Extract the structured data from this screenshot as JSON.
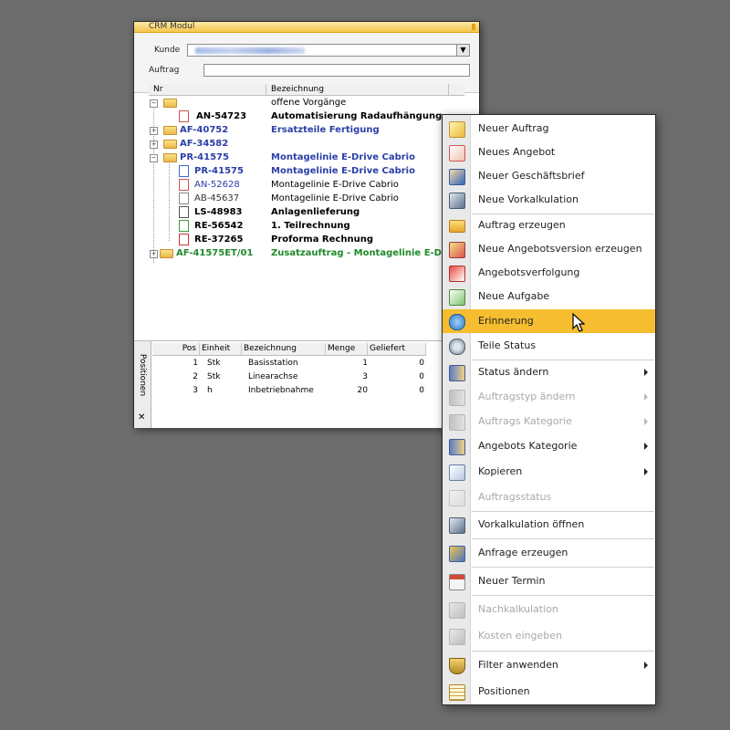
{
  "window": {
    "title": "CRM Modul"
  },
  "form": {
    "kunde_label": "Kunde",
    "auftrag_label": "Auftrag",
    "auftrag_value": ""
  },
  "tree": {
    "col_nr": "Nr",
    "col_bez": "Bezeichnung",
    "rows": [
      {
        "nr": "",
        "bez": "offene Vorgänge"
      },
      {
        "nr": "AN-54723",
        "bez": "Automatisierung Radaufhängung"
      },
      {
        "nr": "AF-40752",
        "bez": "Ersatzteile Fertigung"
      },
      {
        "nr": "AF-34582",
        "bez": ""
      },
      {
        "nr": "PR-41575",
        "bez": "Montagelinie E-Drive Cabrio"
      },
      {
        "nr": "PR-41575",
        "bez": "Montagelinie E-Drive Cabrio"
      },
      {
        "nr": "AN-52628",
        "bez": "Montagelinie E-Drive Cabrio"
      },
      {
        "nr": "AB-45637",
        "bez": "Montagelinie E-Drive Cabrio"
      },
      {
        "nr": "LS-48983",
        "bez": "Anlagenlieferung"
      },
      {
        "nr": "RE-56542",
        "bez": "1. Teilrechnung"
      },
      {
        "nr": "RE-37265",
        "bez": "Proforma Rechnung"
      },
      {
        "nr": "AF-41575ET/01",
        "bez": "Zusatzauftrag - Montagelinie E-Driv..."
      }
    ]
  },
  "positions": {
    "tab_label": "Positionen",
    "close": "✕",
    "headers": {
      "pos": "Pos",
      "einheit": "Einheit",
      "bez": "Bezeichnung",
      "menge": "Menge",
      "geliefert": "Geliefert"
    },
    "rows": [
      {
        "pos": "1",
        "einheit": "Stk",
        "bez": "Basisstation",
        "menge": "1",
        "geliefert": "0"
      },
      {
        "pos": "2",
        "einheit": "Stk",
        "bez": "Linearachse",
        "menge": "3",
        "geliefert": "0"
      },
      {
        "pos": "3",
        "einheit": "h",
        "bez": "Inbetriebnahme",
        "menge": "20",
        "geliefert": "0"
      }
    ]
  },
  "menu": {
    "items": [
      {
        "label": "Neuer Auftrag",
        "icon": "new-order-icon"
      },
      {
        "label": "Neues Angebot",
        "icon": "new-offer-icon"
      },
      {
        "label": "Neuer Geschäftsbrief",
        "icon": "business-letter-icon"
      },
      {
        "label": "Neue Vorkalkulation",
        "icon": "precalculation-icon"
      },
      {
        "label": "Auftrag erzeugen",
        "icon": "create-order-icon"
      },
      {
        "label": "Neue Angebotsversion erzeugen",
        "icon": "offer-version-icon"
      },
      {
        "label": "Angebotsverfolgung",
        "icon": "offer-tracking-icon"
      },
      {
        "label": "Neue Aufgabe",
        "icon": "new-task-icon"
      },
      {
        "label": "Erinnerung",
        "icon": "reminder-icon"
      },
      {
        "label": "Teile Status",
        "icon": "parts-status-icon"
      },
      {
        "label": "Status ändern",
        "icon": "change-status-icon"
      },
      {
        "label": "Auftragstyp ändern",
        "icon": "order-type-icon"
      },
      {
        "label": "Auftrags Kategorie",
        "icon": "order-category-icon"
      },
      {
        "label": "Angebots Kategorie",
        "icon": "offer-category-icon"
      },
      {
        "label": "Kopieren",
        "icon": "copy-icon"
      },
      {
        "label": "Auftragsstatus",
        "icon": "order-status-icon"
      },
      {
        "label": "Vorkalkulation öffnen",
        "icon": "open-precalculation-icon"
      },
      {
        "label": "Anfrage erzeugen",
        "icon": "create-inquiry-icon"
      },
      {
        "label": "Neuer Termin",
        "icon": "new-appointment-icon"
      },
      {
        "label": "Nachkalkulation",
        "icon": "postcalculation-icon"
      },
      {
        "label": "Kosten eingeben",
        "icon": "enter-costs-icon"
      },
      {
        "label": "Filter anwenden",
        "icon": "filter-icon"
      },
      {
        "label": "Positionen",
        "icon": "positions-icon"
      }
    ]
  }
}
